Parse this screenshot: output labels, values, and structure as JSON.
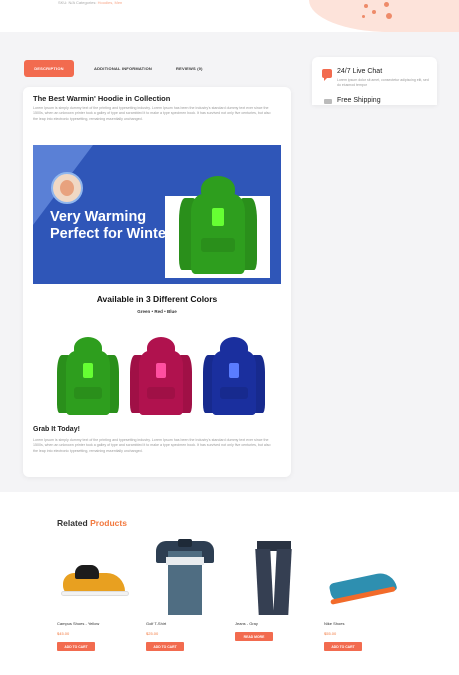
{
  "top": {
    "category_prefix": "SKU: N/A Categories:",
    "category_link": "Hoodies, Men"
  },
  "tabs": {
    "description": "DESCRIPTION",
    "additional": "ADDITIONAL INFORMATION",
    "reviews": "REVIEWS (0)"
  },
  "sidebar": {
    "live_chat_title": "24/7 Live Chat",
    "live_chat_sub": "Lorem ipsum dolor sit amet, consectetur adipiscing elit, sed do eiusmod tempor",
    "shipping_title": "Free Shipping"
  },
  "description": {
    "heading": "The Best Warmin' Hoodie in Collection",
    "intro": "Lorem Ipsum is simply dummy text of the printing and typesetting industry. Lorem Ipsum has been the industry's standard dummy text ever since the 1500s, when an unknown printer took a galley of type and scrambled it to make a type specimen book. It has survived not only five centuries, but also the leap into electronic typesetting, remaining essentially unchanged.",
    "banner_headline": "Very Warming Perfect for Winter",
    "available_title": "Available in 3 Different Colors",
    "available_colors": "Green • Red • Blue",
    "grab_title": "Grab It Today!",
    "grab_text": "Lorem Ipsum is simply dummy text of the printing and typesetting industry. Lorem Ipsum has been the industry's standard dummy text ever since the 1500s, when an unknown printer took a galley of type and scrambled it to make a type specimen book. It has survived not only five centuries, but also the leap into electronic typesetting, remaining essentially unchanged."
  },
  "colors": {
    "accent": "#f26b4f",
    "banner_blue": "#2f56b8",
    "hoodie_green": "#2e9e1e",
    "hoodie_red": "#b0124e",
    "hoodie_blue": "#1a2f9e",
    "llama_neon": "#66ff33"
  },
  "related": {
    "title_prefix": "Related",
    "title_accent": "Products",
    "products": [
      {
        "name": "Campus Shoes - Yellow",
        "price": "$45.00",
        "button": "ADD TO CART"
      },
      {
        "name": "Golf T-Shirt",
        "price": "$25.00",
        "button": "ADD TO CART"
      },
      {
        "name": "Jeans - Gray",
        "price": "",
        "button": "READ MORE"
      },
      {
        "name": "Nike Shoes",
        "price": "$55.00",
        "button": "ADD TO CART"
      }
    ]
  }
}
